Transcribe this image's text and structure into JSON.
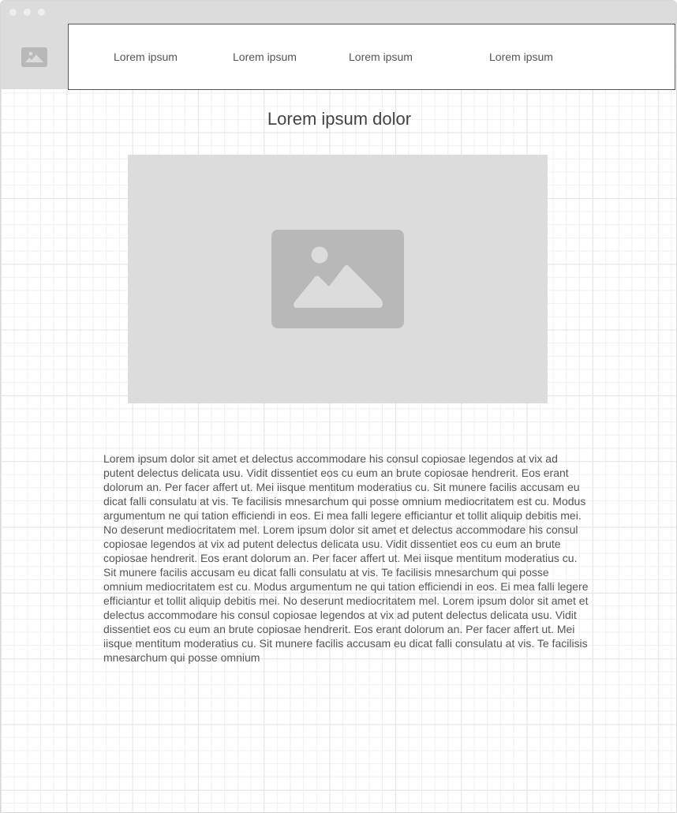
{
  "navigation": {
    "items": [
      {
        "label": "Lorem ipsum"
      },
      {
        "label": "Lorem ipsum"
      },
      {
        "label": "Lorem ipsum"
      },
      {
        "label": "Lorem ipsum"
      }
    ]
  },
  "logo": {
    "icon": "image-placeholder-icon"
  },
  "main": {
    "title": "Lorem ipsum dolor",
    "hero_icon": "image-placeholder-icon",
    "paragraph": "Lorem ipsum dolor sit amet et delectus accommodare his consul copiosae legendos at vix ad putent delectus delicata usu. Vidit dissentiet eos cu eum an brute copiosae hendrerit. Eos erant dolorum an. Per facer affert ut. Mei iisque mentitum moderatius cu. Sit munere facilis accusam eu dicat falli consulatu at vis. Te facilisis mnesarchum qui posse omnium mediocritatem est cu. Modus argumentum ne qui tation efficiendi in eos. Ei mea falli legere efficiantur et tollit aliquip debitis mei. No deserunt mediocritatem mel. Lorem ipsum dolor sit amet et delectus accommodare his consul copiosae legendos at vix ad putent delectus delicata usu. Vidit dissentiet eos cu eum an brute copiosae hendrerit. Eos erant dolorum an. Per facer affert ut. Mei iisque mentitum moderatius cu. Sit munere facilis accusam eu dicat falli consulatu at vis. Te facilisis mnesarchum qui posse omnium mediocritatem est cu. Modus argumentum ne qui tation efficiendi in eos. Ei mea falli legere efficiantur et tollit aliquip debitis mei. No deserunt mediocritatem mel. Lorem ipsum dolor sit amet et delectus accommodare his consul copiosae legendos at vix ad putent delectus delicata usu. Vidit dissentiet eos cu eum an brute copiosae hendrerit. Eos erant dolorum an. Per facer affert ut. Mei iisque mentitum moderatius cu. Sit munere facilis accusam eu dicat falli consulatu at vis. Te facilisis mnesarchum qui posse omnium"
  },
  "colors": {
    "placeholder_bg": "#dcdcdc",
    "placeholder_icon": "#b8b8b8",
    "text": "#555555"
  }
}
